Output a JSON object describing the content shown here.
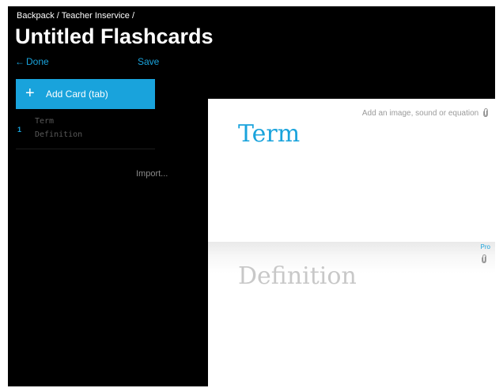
{
  "breadcrumb": {
    "items": [
      "Backpack",
      "Teacher Inservice"
    ],
    "separator": "/"
  },
  "title": "Untitled Flashcards",
  "nav": {
    "done_label": "Done",
    "done_arrow": "←",
    "save_label": "Save"
  },
  "add_card": {
    "plus": "+",
    "label": "Add Card (tab)"
  },
  "cards": [
    {
      "number": "1",
      "term": "Term",
      "definition": "Definition"
    }
  ],
  "import_label": "Import...",
  "editor": {
    "term_placeholder": "Term",
    "definition_placeholder": "Definition",
    "add_media_label": "Add an image, sound or equation",
    "pro_label": "Pro",
    "icons": {
      "attach": "paperclip-icon"
    }
  },
  "colors": {
    "accent": "#19a3dc",
    "background": "#000000",
    "card": "#ffffff"
  }
}
